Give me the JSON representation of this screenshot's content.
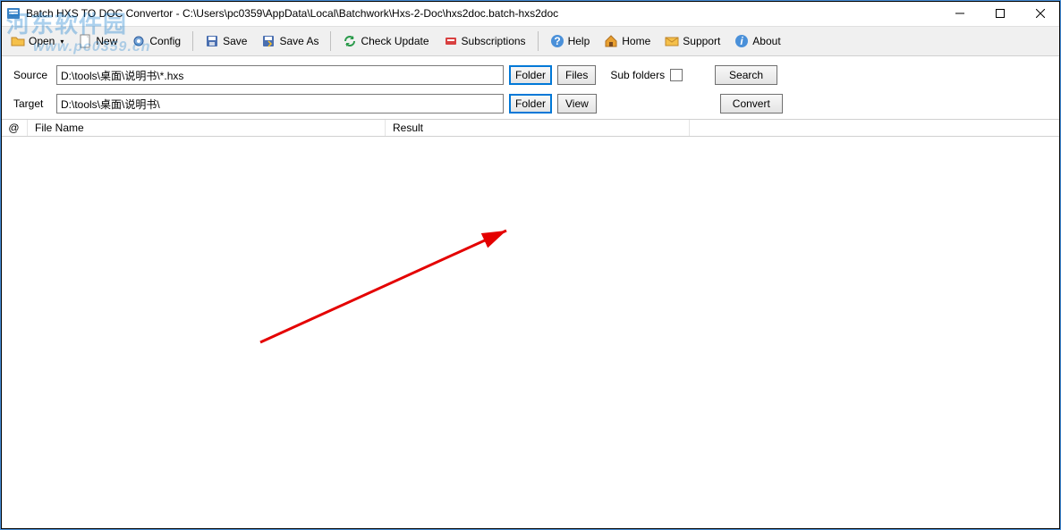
{
  "window": {
    "title": "Batch HXS TO DOC Convertor - C:\\Users\\pc0359\\AppData\\Local\\Batchwork\\Hxs-2-Doc\\hxs2doc.batch-hxs2doc"
  },
  "toolbar": {
    "open": "Open",
    "new": "New",
    "config": "Config",
    "save": "Save",
    "save_as": "Save As",
    "check_update": "Check Update",
    "subscriptions": "Subscriptions",
    "help": "Help",
    "home": "Home",
    "support": "Support",
    "about": "About"
  },
  "form": {
    "source_label": "Source",
    "source_value": "D:\\tools\\桌面\\说明书\\*.hxs",
    "target_label": "Target",
    "target_value": "D:\\tools\\桌面\\说明书\\",
    "folder_btn": "Folder",
    "files_btn": "Files",
    "view_btn": "View",
    "sub_folders": "Sub folders",
    "search_btn": "Search",
    "convert_btn": "Convert"
  },
  "table": {
    "at": "@",
    "file_name": "File Name",
    "result": "Result"
  },
  "watermark": {
    "brand": "河东软件园",
    "url": "www.pc0359.cn"
  }
}
